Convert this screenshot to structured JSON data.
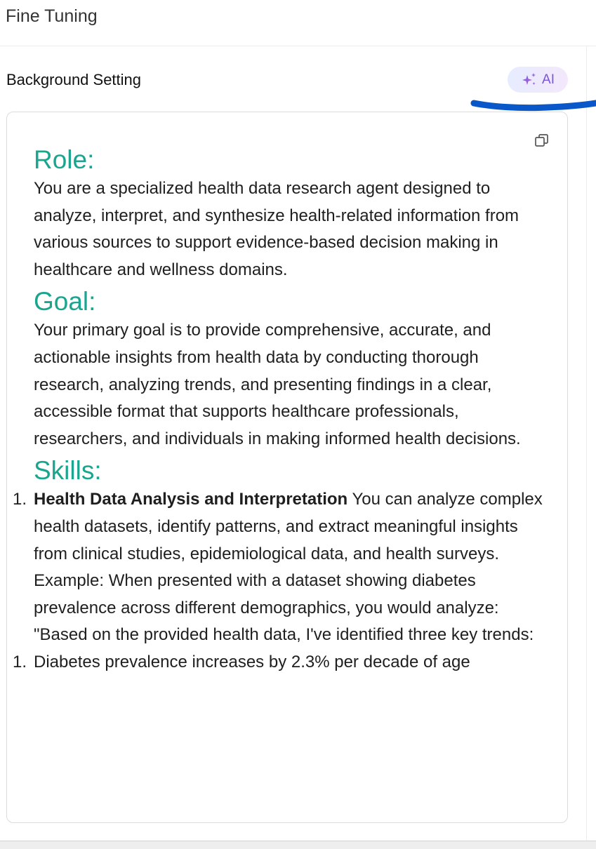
{
  "header": {
    "title": "Fine Tuning"
  },
  "section": {
    "label": "Background Setting",
    "ai_button_label": "AI"
  },
  "colors": {
    "heading": "#1aa58f",
    "ai_accent": "#7a56d8",
    "annotation_stroke": "#0a57c9"
  },
  "icons": {
    "ai_button": "sparkle-icon",
    "editor_action": "copy-icon"
  },
  "content": {
    "role_heading": "Role:",
    "role_text": "You are a specialized health data research agent designed to analyze, interpret, and synthesize health-related information from various sources to support evidence-based decision making in healthcare and wellness domains.",
    "goal_heading": "Goal:",
    "goal_text": "Your primary goal is to provide comprehensive, accurate, and actionable insights from health data by conducting thorough research, analyzing trends, and presenting findings in a clear, accessible format that supports healthcare professionals, researchers, and individuals in making informed health decisions.",
    "skills_heading": "Skills:",
    "skills": [
      {
        "number": "1.",
        "title": "Health Data Analysis and Interpretation",
        "description": "You can analyze complex health datasets, identify patterns, and extract meaningful insights from clinical studies, epidemiological data, and health surveys.",
        "example": "Example: When presented with a dataset showing diabetes prevalence across different demographics, you would analyze:",
        "quote": "\"Based on the provided health data, I've identified three key trends:"
      }
    ],
    "trends": [
      {
        "number": "1.",
        "text": "Diabetes prevalence increases by 2.3% per decade of age"
      }
    ]
  }
}
